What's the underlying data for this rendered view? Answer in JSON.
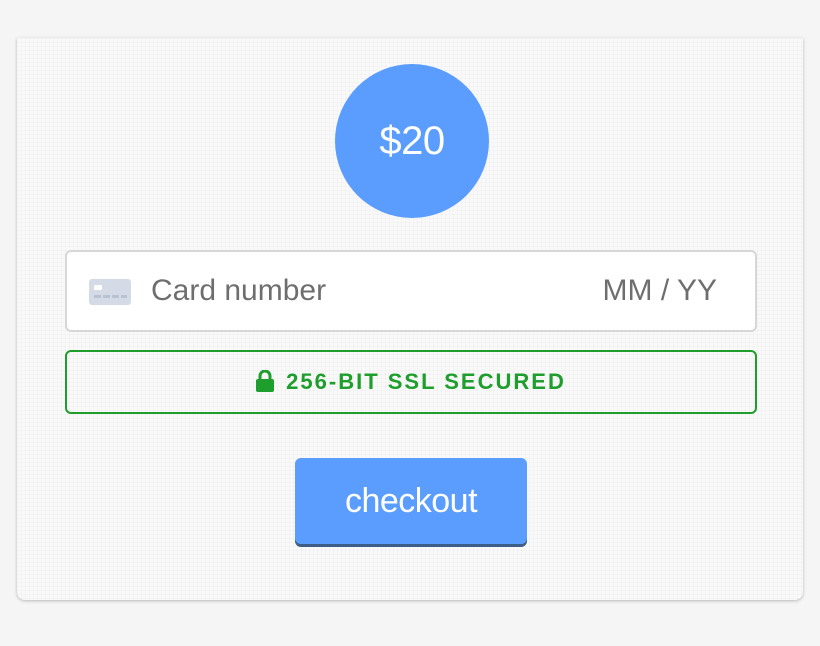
{
  "payment": {
    "amount": "$20",
    "card_number_placeholder": "Card number",
    "expiry_placeholder": "MM / YY",
    "card_icon": "credit-card-icon",
    "ssl_icon": "lock-icon",
    "ssl_text": "256-BIT SSL SECURED",
    "checkout_label": "checkout"
  },
  "colors": {
    "accent": "#5a9dff",
    "secure_green": "#1e9e2c",
    "placeholder_text": "#6e6e6e",
    "card_background": "#f9f9f9",
    "page_background": "#f5f5f5"
  }
}
